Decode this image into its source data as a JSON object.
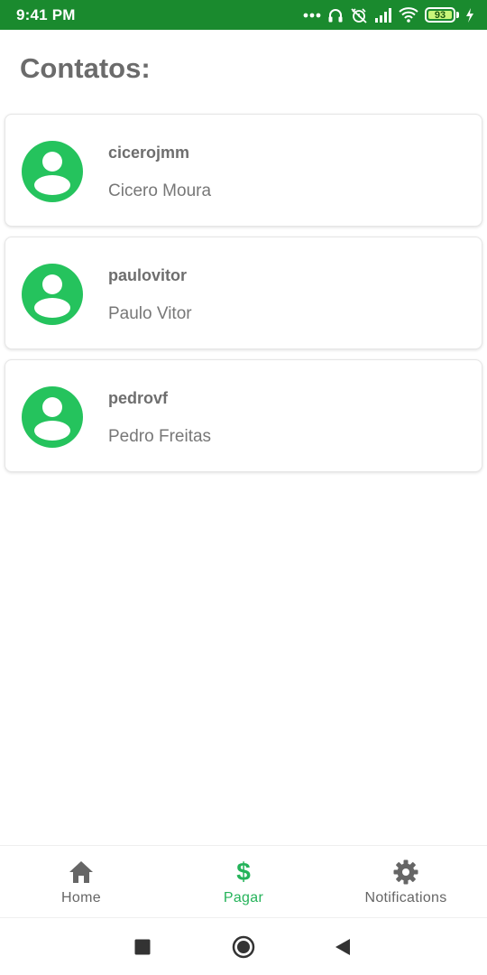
{
  "status_bar": {
    "time": "9:41 PM",
    "battery_level": "93",
    "icons": [
      "more-dots-icon",
      "headphones-icon",
      "alarm-off-icon",
      "signal-icon",
      "wifi-icon",
      "battery-icon",
      "charging-icon"
    ]
  },
  "page": {
    "title": "Contatos:"
  },
  "contacts": [
    {
      "username": "cicerojmm",
      "name": "Cicero Moura"
    },
    {
      "username": "paulovitor",
      "name": "Paulo Vitor"
    },
    {
      "username": "pedrovf",
      "name": "Pedro Freitas"
    }
  ],
  "bottom_nav": {
    "items": [
      {
        "label": "Home",
        "icon": "home-icon"
      },
      {
        "label": "Pagar",
        "icon": "dollar-icon",
        "symbol": "$"
      },
      {
        "label": "Notifications",
        "icon": "gear-icon"
      }
    ],
    "active": "Pagar"
  },
  "colors": {
    "status_bar": "#1a8a2e",
    "accent": "#25c35d",
    "title_text": "#6b6b6b"
  }
}
